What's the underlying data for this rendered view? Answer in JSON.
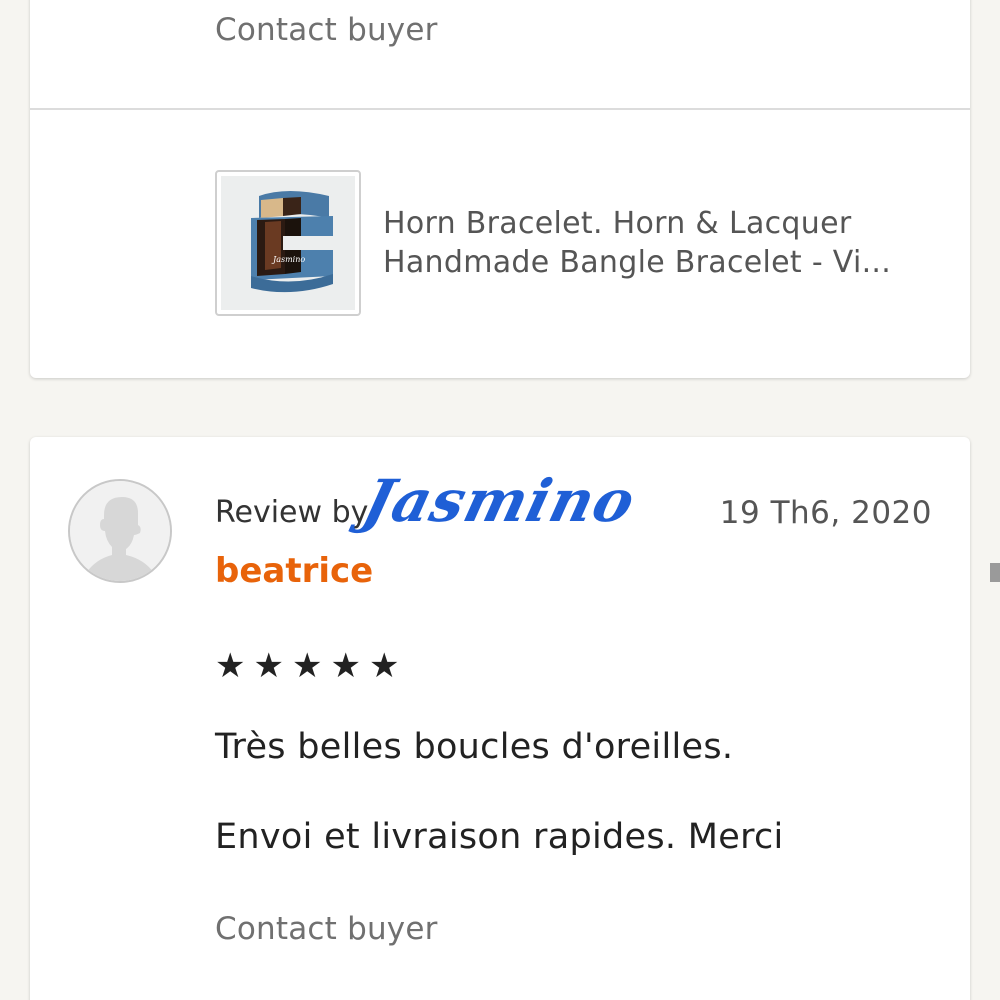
{
  "top_card": {
    "contact_label": "Contact buyer",
    "product": {
      "title_line1": "Horn Bracelet. Horn & Lacquer",
      "title_line2": "Handmade Bangle Bracelet - Vi...",
      "thumb_icon": "bracelet-thumbnail"
    }
  },
  "review": {
    "review_by_label": "Review by",
    "reviewer": "beatrice",
    "date": "19 Th6, 2020",
    "watermark": "Jasmino",
    "rating": 5,
    "stars": [
      "★",
      "★",
      "★",
      "★",
      "★"
    ],
    "line1": "Très belles boucles d'oreilles.",
    "line2": "Envoi et livraison rapides. Merci",
    "contact_label": "Contact buyer"
  },
  "colors": {
    "reviewer_name": "#e8630a",
    "watermark": "#1f5fd6",
    "background": "#f6f5f1"
  }
}
